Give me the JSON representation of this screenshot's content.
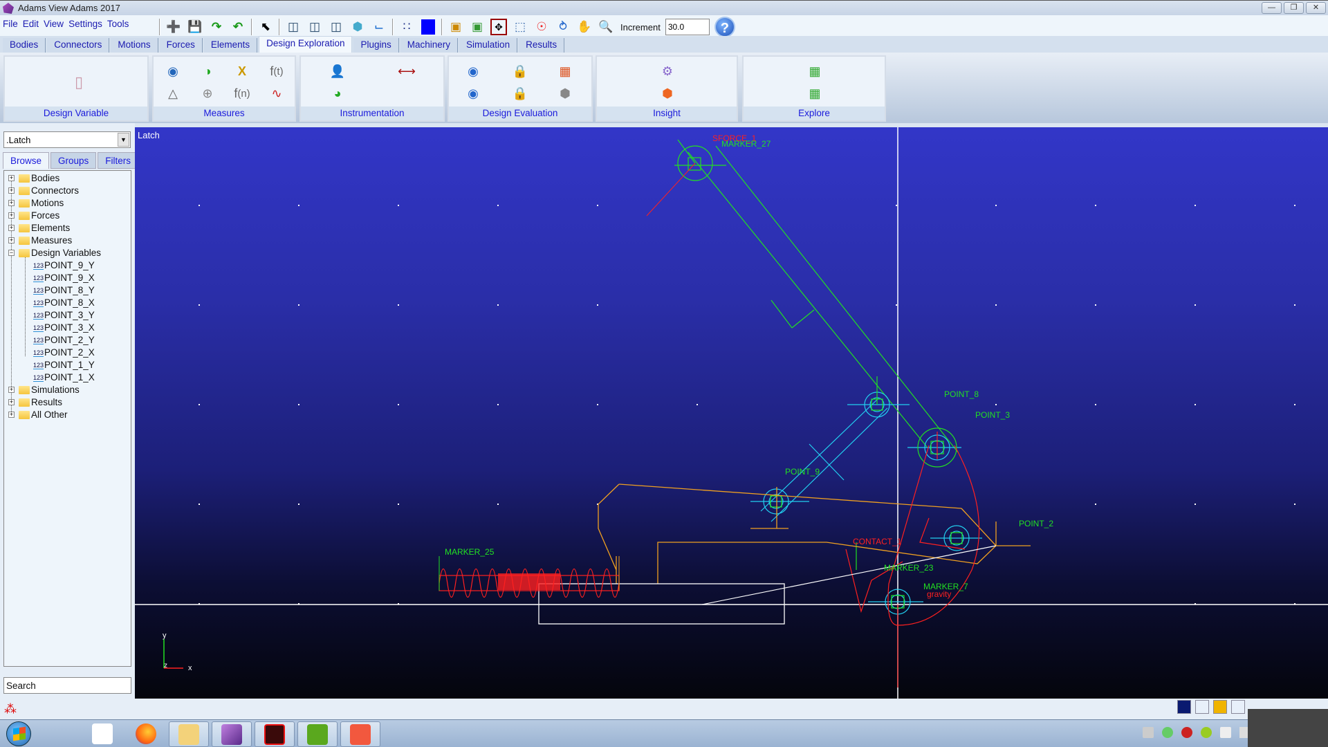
{
  "window": {
    "title": "Adams View Adams 2017",
    "controls": [
      "minimize",
      "restore",
      "close"
    ]
  },
  "menu": [
    "File",
    "Edit",
    "View",
    "Settings",
    "Tools"
  ],
  "toolbar": {
    "icons": [
      "new-model-icon",
      "save-icon",
      "undo-icon",
      "redo-icon",
      "select-arrow-icon",
      "render-solid-icon",
      "render-wireframe-icon",
      "render-hidden-icon",
      "iso-view-icon",
      "coordinate-system-icon",
      "grid-icon",
      "color-icon",
      "shadow-icon",
      "fit-icon",
      "translate-icon",
      "zoom-box-icon",
      "center-icon",
      "rotate-icon",
      "pan-icon",
      "zoom-icon"
    ],
    "increment_label": "Increment",
    "increment_value": "30.0",
    "help_label": "?"
  },
  "tabs": [
    {
      "label": "Bodies"
    },
    {
      "label": "Connectors"
    },
    {
      "label": "Motions"
    },
    {
      "label": "Forces"
    },
    {
      "label": "Elements"
    },
    {
      "label": "Design Exploration",
      "active": true
    },
    {
      "label": "Plugins"
    },
    {
      "label": "Machinery"
    },
    {
      "label": "Simulation"
    },
    {
      "label": "Results"
    }
  ],
  "ribbon": {
    "groups": [
      {
        "label": "Design Variable"
      },
      {
        "label": "Measures"
      },
      {
        "label": "Instrumentation"
      },
      {
        "label": "Design Evaluation"
      },
      {
        "label": "Insight"
      },
      {
        "label": "Explore"
      }
    ]
  },
  "browser": {
    "model_select": ".Latch",
    "tabs": [
      "Browse",
      "Groups",
      "Filters"
    ],
    "active_tab": "Browse",
    "tree": [
      {
        "label": "Bodies"
      },
      {
        "label": "Connectors"
      },
      {
        "label": "Motions"
      },
      {
        "label": "Forces"
      },
      {
        "label": "Elements"
      },
      {
        "label": "Measures"
      },
      {
        "label": "Design Variables",
        "expanded": true,
        "children": [
          "POINT_9_Y",
          "POINT_9_X",
          "POINT_8_Y",
          "POINT_8_X",
          "POINT_3_Y",
          "POINT_3_X",
          "POINT_2_Y",
          "POINT_2_X",
          "POINT_1_Y",
          "POINT_1_X"
        ]
      },
      {
        "label": "Simulations"
      },
      {
        "label": "Results"
      },
      {
        "label": "All Other"
      }
    ],
    "search_placeholder": "Search"
  },
  "viewport": {
    "model_label": "Latch",
    "labels": {
      "sforce": "SFORCE_1",
      "marker27": "MARKER_27",
      "point8": "POINT_8",
      "point3": "POINT_3",
      "point9": "POINT_9",
      "point2": "POINT_2",
      "contact": "CONTACT_1",
      "marker23": "MARKER_23",
      "marker7": "MARKER_7",
      "gravity": "gravity",
      "marker25": "MARKER_25"
    },
    "triad": {
      "x": "x",
      "y": "y",
      "z": "z"
    }
  },
  "colors": {
    "accent": "#1a1adb",
    "viewport_top": "#3236c8",
    "viewport_bottom": "#04050c",
    "green": "#22e022",
    "red": "#ff1a1a",
    "orange": "#f0a020",
    "cyan": "#22d0f0"
  }
}
